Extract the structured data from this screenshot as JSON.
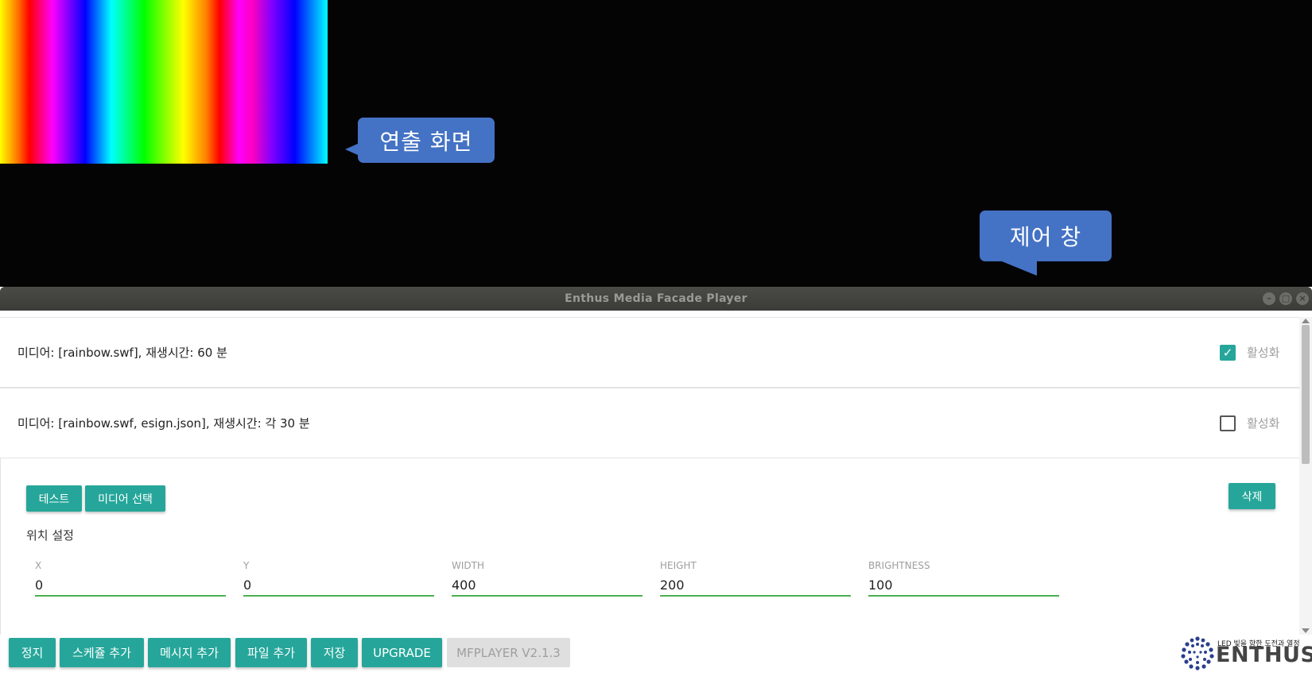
{
  "callouts": {
    "output": "연출 화면",
    "control": "제어 창"
  },
  "window": {
    "title": "Enthus Media Facade Player",
    "controls": [
      "minimize-icon",
      "maximize-icon",
      "close-icon"
    ]
  },
  "media_rows": [
    {
      "text": "미디어: [rainbow.swf], 재생시간: 60 분",
      "active_label": "활성화",
      "checked": true
    },
    {
      "text": "미디어: [rainbow.swf, esign.json], 재생시간: 각 30 분",
      "active_label": "활성화",
      "checked": false
    }
  ],
  "panel": {
    "test_label": "테스트",
    "select_media_label": "미디어 선택",
    "delete_label": "삭제",
    "position_title": "위치 설정",
    "fields": {
      "x": {
        "label": "X",
        "value": "0"
      },
      "y": {
        "label": "Y",
        "value": "0"
      },
      "width": {
        "label": "WIDTH",
        "value": "400"
      },
      "height": {
        "label": "HEIGHT",
        "value": "200"
      },
      "brightness": {
        "label": "BRIGHTNESS",
        "value": "100"
      }
    }
  },
  "footer": {
    "stop": "정지",
    "add_schedule": "스케쥴 추가",
    "add_message": "메시지 추가",
    "add_file": "파일 추가",
    "save": "저장",
    "upgrade": "UPGRADE",
    "version": "MFPLAYER V2.1.3"
  },
  "logo": {
    "tagline": "LED 빛을 향한 도전과 열정",
    "wordmark": "ENTHUS"
  },
  "colors": {
    "accent": "#26a69a",
    "callout": "#4472c4",
    "underline": "#4caf50"
  }
}
